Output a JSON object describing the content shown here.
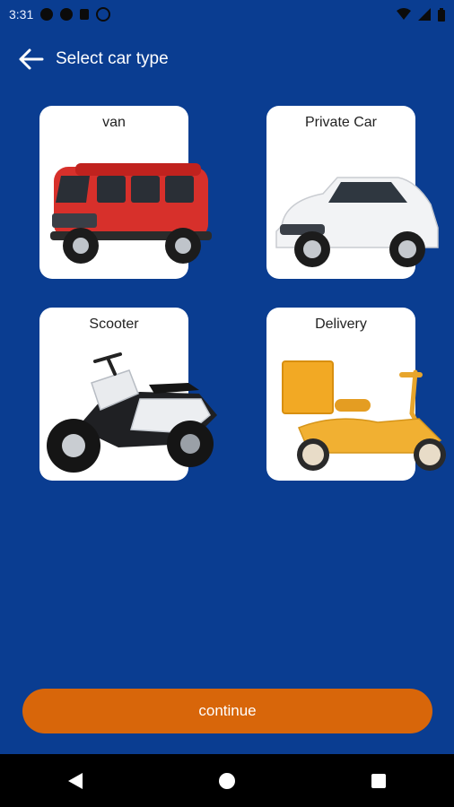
{
  "status_bar": {
    "time": "3:31",
    "icons": [
      "notification-dot-icon",
      "notification-dot-icon",
      "sd-card-icon",
      "sync-icon",
      "wifi-icon",
      "signal-icon",
      "battery-icon"
    ]
  },
  "app_bar": {
    "title": "Select car type",
    "back_icon": "arrow-left-icon"
  },
  "vehicle_types": [
    {
      "label": "van",
      "image": "red-van"
    },
    {
      "label": "Private Car",
      "image": "white-suv"
    },
    {
      "label": "Scooter",
      "image": "motor-scooter"
    },
    {
      "label": "Delivery",
      "image": "yellow-delivery-vespa"
    }
  ],
  "continue_label": "continue",
  "nav_bar": [
    "back-triangle-icon",
    "home-circle-icon",
    "recents-square-icon"
  ],
  "colors": {
    "background": "#0a3d91",
    "accent": "#d8660a",
    "card": "#ffffff"
  }
}
